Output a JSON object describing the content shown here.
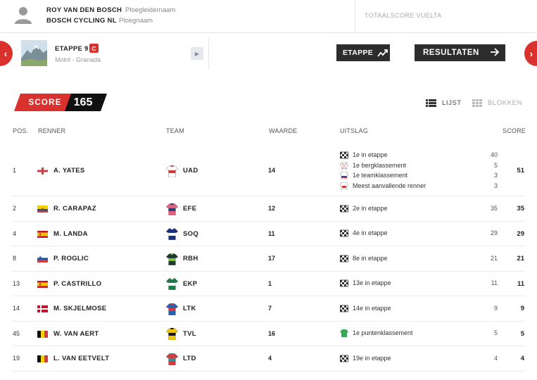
{
  "manager": {
    "name": "ROY VAN DEN BOSCH",
    "role": "Ploegleidernaam",
    "team": "BOSCH CYCLING NL",
    "team_role": "Ploegnaam",
    "total_label": "TOTAALSCORE VUELTA"
  },
  "stage": {
    "title": "ETAPPE 9",
    "badge": "C",
    "route": "Motril - Granada",
    "prev_icon": "chevron-left-icon",
    "next_icon": "chevron-right-icon",
    "etappe_button": "ETAPPE",
    "results_button": "RESULTATEN"
  },
  "score": {
    "label": "SCORE",
    "value": "165"
  },
  "view": {
    "list_label": "LIJST",
    "blocks_label": "BLOKKEN"
  },
  "columns": {
    "pos": "POS.",
    "rider": "RENNER",
    "team": "TEAM",
    "value": "WAARDE",
    "result": "UITSLAG",
    "score": "SCORE"
  },
  "colors": {
    "accent": "#d9322e",
    "dark": "#2d2d2d"
  },
  "rows": [
    {
      "pos": "1",
      "flag": "england",
      "name": "A. YATES",
      "team": "UAD",
      "value": "14",
      "score": "51",
      "jersey": [
        "#ffffff",
        "#d23c3c"
      ],
      "results": [
        {
          "icon": "checkered-flag-icon",
          "text": "1e in etappe",
          "points": "40"
        },
        {
          "icon": "polka-jersey-icon",
          "text": "1e bergklassement",
          "points": "5"
        },
        {
          "icon": "team-jersey-icon",
          "text": "1e teamklassement",
          "points": "3"
        },
        {
          "icon": "combative-jersey-icon",
          "text": "Meest aanvallende renner",
          "points": "3"
        }
      ]
    },
    {
      "pos": "2",
      "flag": "ecuador",
      "name": "R. CARAPAZ",
      "team": "EFE",
      "value": "12",
      "score": "35",
      "jersey": [
        "#e0607e",
        "#2a3a6a"
      ],
      "results": [
        {
          "icon": "checkered-flag-icon",
          "text": "2e in etappe",
          "points": "35"
        }
      ]
    },
    {
      "pos": "4",
      "flag": "spain",
      "name": "M. LANDA",
      "team": "SOQ",
      "value": "11",
      "score": "29",
      "jersey": [
        "#1b2f7a",
        "#ffffff"
      ],
      "results": [
        {
          "icon": "checkered-flag-icon",
          "text": "4e in etappe",
          "points": "29"
        }
      ]
    },
    {
      "pos": "8",
      "flag": "slovenia",
      "name": "P. ROGLIC",
      "team": "RBH",
      "value": "17",
      "score": "21",
      "jersey": [
        "#1f3a30",
        "#7fc24a"
      ],
      "results": [
        {
          "icon": "checkered-flag-icon",
          "text": "8e in etappe",
          "points": "21"
        }
      ]
    },
    {
      "pos": "13",
      "flag": "spain",
      "name": "P. CASTRILLO",
      "team": "EKP",
      "value": "1",
      "score": "11",
      "jersey": [
        "#1e7a4a",
        "#ffffff"
      ],
      "results": [
        {
          "icon": "checkered-flag-icon",
          "text": "13e in etappe",
          "points": "11"
        }
      ]
    },
    {
      "pos": "14",
      "flag": "denmark",
      "name": "M. SKJELMOSE",
      "team": "LTK",
      "value": "7",
      "score": "9",
      "jersey": [
        "#2b5fb0",
        "#d23c3c"
      ],
      "results": [
        {
          "icon": "checkered-flag-icon",
          "text": "14e in etappe",
          "points": "9"
        }
      ]
    },
    {
      "pos": "45",
      "flag": "belgium",
      "name": "W. VAN AERT",
      "team": "TVL",
      "value": "16",
      "score": "5",
      "jersey": [
        "#f1c40f",
        "#111111"
      ],
      "results": [
        {
          "icon": "green-jersey-icon",
          "text": "1e puntenklassement",
          "points": "5"
        }
      ]
    },
    {
      "pos": "19",
      "flag": "belgium",
      "name": "L. VAN EETVELT",
      "team": "LTD",
      "value": "4",
      "score": "4",
      "jersey": [
        "#d23c3c",
        "#3a8a9a"
      ],
      "results": [
        {
          "icon": "checkered-flag-icon",
          "text": "19e in etappe",
          "points": "4"
        }
      ]
    }
  ]
}
